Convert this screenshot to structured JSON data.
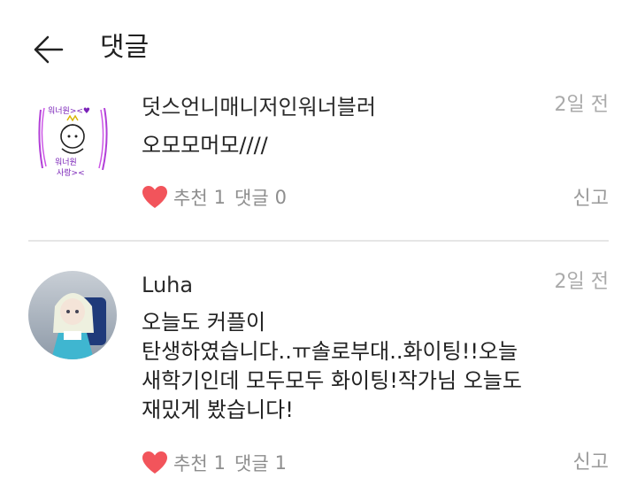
{
  "header": {
    "title": "댓글"
  },
  "comments": [
    {
      "author": "덧스언니매니저인워너블러",
      "time": "2일 전",
      "lines": [
        "오모모머모////"
      ],
      "like_label": "추천",
      "like_count": "1",
      "reply_label": "댓글",
      "reply_count": "0",
      "report_label": "신고",
      "avatar_doodle_text": [
        "워너원><♥",
        "워너원",
        "사랑><"
      ]
    },
    {
      "author": "Luha",
      "time": "2일 전",
      "lines": [
        "오늘도 커플이",
        "탄생하였습니다..ㅠ솔로부대..화이팅!!오늘",
        "새학기인데 모두모두 화이팅!작가님 오늘도",
        "재밌게 봤습니다!"
      ],
      "like_label": "추천",
      "like_count": "1",
      "reply_label": "댓글",
      "reply_count": "1",
      "report_label": "신고"
    }
  ],
  "colors": {
    "heart": "#f2545b",
    "divider": "#e6e6e6",
    "muted": "#8e8e8e",
    "time": "#aaaaaa"
  }
}
